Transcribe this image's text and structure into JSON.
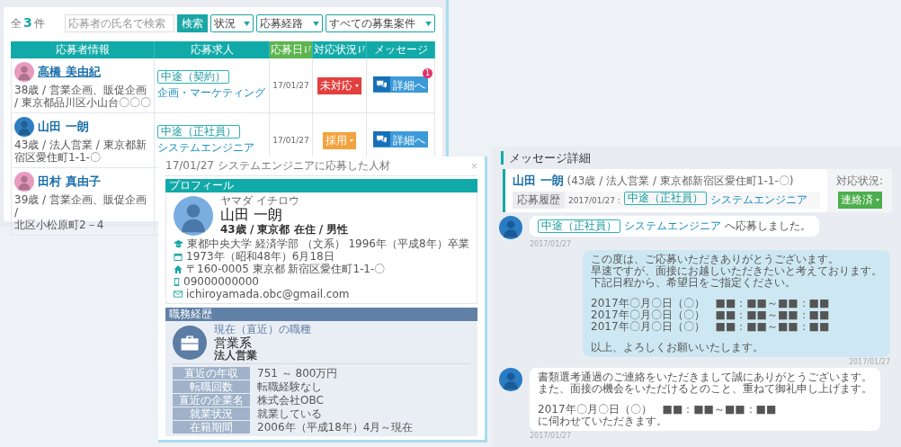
{
  "list": {
    "count": {
      "prefix": "全",
      "value": "3",
      "suffix": "件"
    },
    "search": {
      "placeholder": "応募者の氏名で検索",
      "button": "検索"
    },
    "filters": [
      "状況",
      "応募経路",
      "すべての募集案件"
    ],
    "columns": [
      {
        "label": "応募者情報",
        "sortable": false,
        "selected": false
      },
      {
        "label": "応募求人",
        "sortable": false,
        "selected": false
      },
      {
        "label": "応募日",
        "sortable": true,
        "selected": true
      },
      {
        "label": "対応状況",
        "sortable": true,
        "selected": false
      },
      {
        "label": "メッセージ",
        "sortable": false,
        "selected": false
      }
    ],
    "rows": [
      {
        "name": "高橋 美由紀",
        "hovered": true,
        "color": "#e89bbf",
        "detail_lines": [
          "38歳 / 営業企画、販促企画 / 東京都品川区小山台〇〇〇"
        ],
        "job_tag": "中途（契約）",
        "job_title": "企画・マーケティング",
        "date": "17/01/27",
        "status": {
          "label": "未対応",
          "color": "#e2403e"
        },
        "message": {
          "label": "詳細へ",
          "badge": "1"
        }
      },
      {
        "name": "山田 一朗",
        "hovered": false,
        "color": "#2f7fc1",
        "detail_lines": [
          "43歳 / 法人営業 / 東京都新宿区愛住町1-1-〇"
        ],
        "job_tag": "中途（正社員）",
        "job_title": "システムエンジニア",
        "date": "17/01/27",
        "status": {
          "label": "採用",
          "color": "#f3a33e"
        },
        "message": {
          "label": "詳細へ"
        }
      },
      {
        "name": "田村 真由子",
        "hovered": false,
        "color": "#e89bbf",
        "detail_lines": [
          "39歳 / 営業企画、販促企画 /",
          "北区小松原町2－4"
        ]
      }
    ]
  },
  "modal": {
    "title": "17/01/27 システムエンジニアに応募した人材",
    "close": "×",
    "profile": {
      "heading": "プロフィール",
      "kana": "ヤマダ イチロウ",
      "name": "山田 一朗",
      "meta": "43歳 / 東京都 在住 / 男性",
      "items": [
        {
          "kind": "education",
          "text": "東都中央大学 経済学部 （文系） 1996年（平成8年）卒業"
        },
        {
          "kind": "birthday",
          "text": "1973年（昭和48年）6月18日"
        },
        {
          "kind": "address",
          "text": "〒160-0005 東京都 新宿区愛住町1-1-〇"
        },
        {
          "kind": "phone",
          "text": "09000000000"
        },
        {
          "kind": "email",
          "text": "ichiroyamada.obc@gmail.com"
        }
      ]
    },
    "career": {
      "heading": "職務経歴",
      "caption": "現在（直近）の職種",
      "category": "営業系",
      "role": "法人営業",
      "rows": [
        {
          "label": "直近の年収",
          "value": "751 ～ 800万円"
        },
        {
          "label": "転職回数",
          "value": "転職経験なし"
        },
        {
          "label": "直近の企業名",
          "value": "株式会社OBC"
        },
        {
          "label": "就業状況",
          "value": "就業している"
        },
        {
          "label": "在籍期間",
          "value": "2006年（平成18年）4月～現在"
        }
      ]
    }
  },
  "messages": {
    "title": "メッセージ詳細",
    "applicant": {
      "name": "山田 一朗",
      "meta": "(43歳 / 法人営業 / 東京都新宿区愛住町1-1-〇)",
      "history_label": "応募履歴",
      "history_date": "2017/01/27 :",
      "tag": "中途（正社員）",
      "job": "システムエンジニア",
      "status_label": "対応状況:",
      "status": {
        "label": "連絡済",
        "color": "#4cae4c"
      }
    },
    "items": [
      {
        "kind": "incoming",
        "tag": "中途（正社員）",
        "link": "システムエンジニア",
        "text": "へ応募しました。",
        "time": "2017/01/27"
      },
      {
        "kind": "outgoing",
        "paragraphs": [
          [
            "この度は、ご応募いただきありがとうございます。",
            "早速ですが、面接にお越しいただきたいと考えております。",
            "下記日程から、希望日をご指定ください。"
          ],
          [
            "2017年〇月〇日（〇）　■■：■■～■■：■■",
            "2017年〇月〇日（〇）　■■：■■～■■：■■",
            "2017年〇月〇日（〇）　■■：■■～■■：■■"
          ],
          [
            "以上、よろしくお願いいたします。"
          ]
        ],
        "time": "2017/01/27"
      },
      {
        "kind": "incoming",
        "paragraphs": [
          [
            "書類選考通過のご連絡をいただきまして誠にありがとうございます。",
            "また、面接の機会をいただけるとのこと、重ねて御礼申し上げます。"
          ],
          [
            "2017年〇月〇日（〇）　■■：■■～■■：■■",
            "に伺わせていただきます。"
          ]
        ],
        "time": "2017/01/27"
      }
    ]
  }
}
